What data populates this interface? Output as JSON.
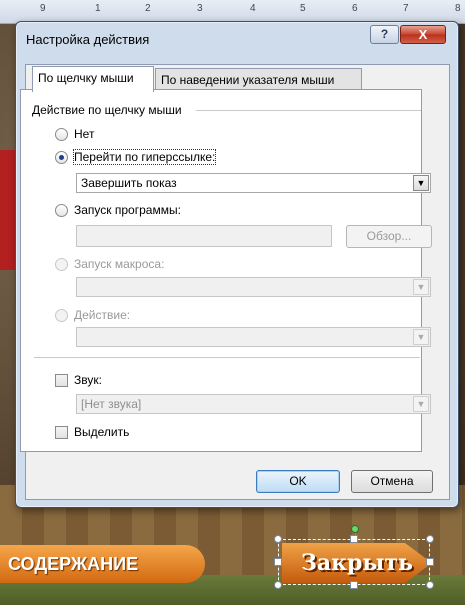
{
  "ruler": {
    "numbers": [
      "9",
      "1",
      "2",
      "3",
      "4",
      "5",
      "6",
      "7",
      "8"
    ]
  },
  "slide": {
    "content_button": "СОДЕРЖАНИЕ",
    "close_button": "Закрыть"
  },
  "dialog": {
    "title": "Настройка действия",
    "help_label": "?",
    "close_label": "X",
    "tabs": [
      {
        "label": "По щелчку мыши",
        "active": true
      },
      {
        "label": "По наведении указателя мыши",
        "active": false
      }
    ],
    "group_title": "Действие по щелчку мыши",
    "options": {
      "none": "Нет",
      "hyperlink": "Перейти по гиперссылке:",
      "hyperlink_value": "Завершить показ",
      "run_program": "Запуск программы:",
      "browse": "Обзор...",
      "run_macro": "Запуск макроса:",
      "action": "Действие:"
    },
    "sound": {
      "label": "Звук:",
      "value": "[Нет звука]"
    },
    "highlight": "Выделить",
    "ok": "OK",
    "cancel": "Отмена"
  }
}
